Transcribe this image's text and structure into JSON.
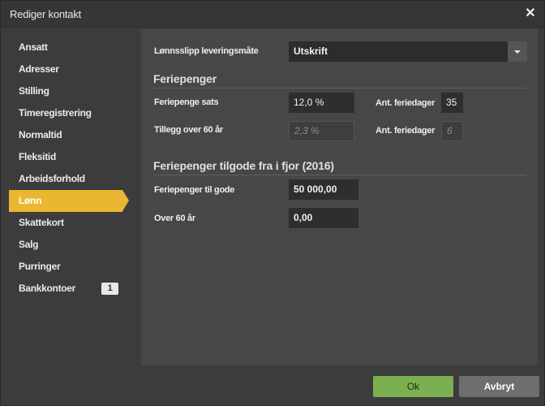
{
  "dialog": {
    "title": "Rediger kontakt",
    "close_glyph": "✕"
  },
  "sidebar": {
    "items": [
      {
        "label": "Ansatt"
      },
      {
        "label": "Adresser"
      },
      {
        "label": "Stilling"
      },
      {
        "label": "Timeregistrering"
      },
      {
        "label": "Normaltid"
      },
      {
        "label": "Fleksitid"
      },
      {
        "label": "Arbeidsforhold"
      },
      {
        "label": "Lønn",
        "active": true
      },
      {
        "label": "Skattekort"
      },
      {
        "label": "Salg"
      },
      {
        "label": "Purringer"
      },
      {
        "label": "Bankkontoer",
        "badge": "1"
      }
    ]
  },
  "form": {
    "delivery_label": "Lønnsslipp leveringsmåte",
    "delivery_value": "Utskrift",
    "section_holiday": "Feriepenger",
    "holiday_rate_label": "Feriepenge sats",
    "holiday_rate_value": "12,0 %",
    "holiday_days_label": "Ant. feriedager",
    "holiday_days_value": "35",
    "over60_label": "Tillegg over 60 år",
    "over60_value": "2,3 %",
    "over60_days_label": "Ant. feriedager",
    "over60_days_value": "6",
    "section_due": "Feriepenger tilgode fra i fjor (2016)",
    "due_label": "Feriepenger til gode",
    "due_value": "50 000,00",
    "due_over60_label": "Over 60 år",
    "due_over60_value": "0,00"
  },
  "footer": {
    "ok_label": "Ok",
    "cancel_label": "Avbryt"
  },
  "colors": {
    "accent": "#e9b731",
    "ok_button": "#7ab050",
    "background": "#3c3c3c",
    "panel": "#474747"
  }
}
